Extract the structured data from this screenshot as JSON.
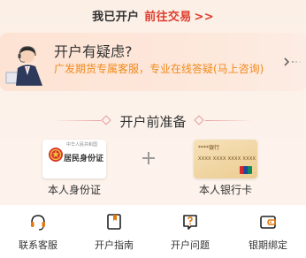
{
  "top": {
    "prefix": "我已开户",
    "link": "前往交易",
    "arrows": ">>"
  },
  "consult": {
    "title": "开户有疑虑?",
    "subtitle": "广发期货专属客服，专业在线答疑(马上咨询)",
    "chevron_icon": "chevron-right-icon",
    "agent_icon": "customer-service-agent-icon"
  },
  "section": {
    "title": "开户前准备"
  },
  "id_card": {
    "small_text": "中华人民共和国",
    "big_text": "居民身份证",
    "label": "本人身份证",
    "emblem_icon": "national-emblem-icon"
  },
  "bank_card": {
    "bank_name": "****银行",
    "card_number": "XXXX XXXX XXXX XXXX",
    "chip_icon": "unionpay-logo-icon",
    "label": "本人银行卡"
  },
  "nav": {
    "items": [
      {
        "label": "联系客服",
        "icon": "headset-icon"
      },
      {
        "label": "开户指南",
        "icon": "book-icon"
      },
      {
        "label": "开户问题",
        "icon": "question-icon"
      },
      {
        "label": "银期绑定",
        "icon": "wallet-icon"
      }
    ]
  },
  "colors": {
    "accent_red": "#e03c2d",
    "accent_orange": "#f08a1c",
    "nav_icon": "#e07a10"
  }
}
